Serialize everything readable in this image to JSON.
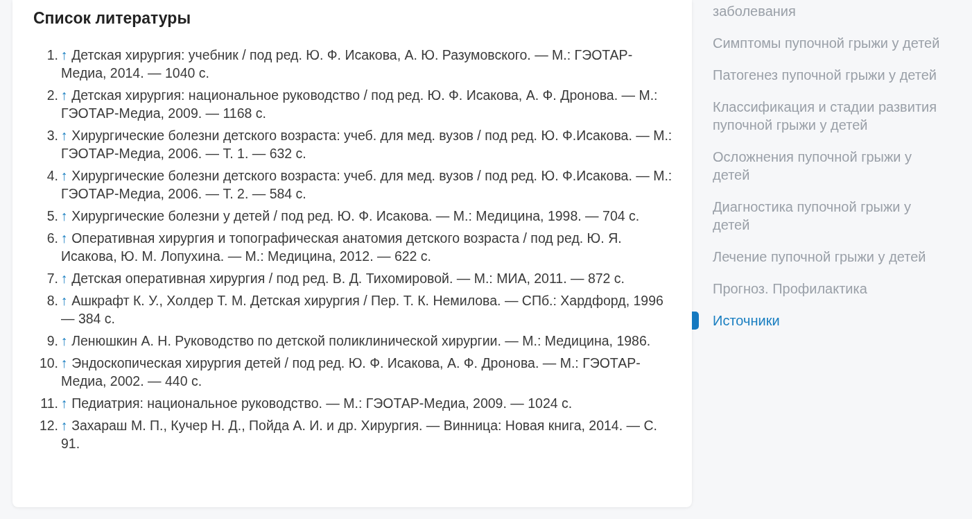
{
  "references": {
    "title": "Список литературы",
    "items": [
      {
        "number": "1.",
        "backlink": "↑",
        "text": "Детская хирургия: учебник / под ред. Ю. Ф. Исакова, А. Ю. Разумовского. — М.: ГЭОТАР-Медиа, 2014. — 1040 с."
      },
      {
        "number": "2.",
        "backlink": "↑",
        "text": "Детская хирургия: национальное руководство / под ред. Ю. Ф. Исакова, А. Ф. Дронова. — М.: ГЭОТАР-Медиа, 2009. — 1168 с."
      },
      {
        "number": "3.",
        "backlink": "↑",
        "text": "Хирургические болезни детского возраста: учеб. для мед. вузов / под ред. Ю. Ф.Исакова. — М.: ГЭОТАР-Медиа, 2006. — Т. 1. — 632 с."
      },
      {
        "number": "4.",
        "backlink": "↑",
        "text": "Хирургические болезни детского возраста: учеб. для мед. вузов / под ред. Ю. Ф.Исакова. — М.: ГЭОТАР-Медиа, 2006. — Т. 2. — 584 с."
      },
      {
        "number": "5.",
        "backlink": "↑",
        "text": "Хирургические болезни у детей / под ред. Ю. Ф. Исакова. — М.: Медицина, 1998. — 704 с."
      },
      {
        "number": "6.",
        "backlink": "↑",
        "text": "Оперативная хирургия и топографическая анатомия детского возраста / под ред. Ю. Я. Исакова, Ю. М. Лопухина. — М.: Медицина, 2012. — 622 с."
      },
      {
        "number": "7.",
        "backlink": "↑",
        "text": "Детская оперативная хирургия / под ред. В. Д. Тихомировой. — М.: МИА, 2011. — 872 с."
      },
      {
        "number": "8.",
        "backlink": "↑",
        "text": "Ашкрафт К. У., Холдер Т. М. Детская хирургия / Пер. Т. К. Немилова. — СПб.: Хардфорд, 1996 — 384 с."
      },
      {
        "number": "9.",
        "backlink": "↑",
        "text": "Ленюшкин А. Н. Руководство по детской поликлинической хирургии. — М.: Медицина, 1986."
      },
      {
        "number": "10.",
        "backlink": "↑",
        "text": "Эндоскопическая хирургия детей / под ред. Ю. Ф. Исакова, А. Ф. Дронова. — М.: ГЭОТАР-Медиа, 2002. — 440 с."
      },
      {
        "number": "11.",
        "backlink": "↑",
        "text": "Педиатрия: национальное руководство. — М.: ГЭОТАР-Медиа, 2009. — 1024 с."
      },
      {
        "number": "12.",
        "backlink": "↑",
        "text": "Захараш М. П., Кучер Н. Д., Пойда А. И. и др. Хирургия. — Винница: Новая книга, 2014. — С. 91."
      }
    ]
  },
  "sidebar": {
    "items": [
      {
        "label": "заболевания",
        "selected": false
      },
      {
        "label": "Симптомы пупочной грыжи у детей",
        "selected": false
      },
      {
        "label": "Патогенез пупочной грыжи у детей",
        "selected": false
      },
      {
        "label": "Классификация и стадии развития пупочной грыжи у детей",
        "selected": false
      },
      {
        "label": "Осложнения пупочной грыжи у детей",
        "selected": false
      },
      {
        "label": "Диагностика пупочной грыжи у детей",
        "selected": false
      },
      {
        "label": "Лечение пупочной грыжи у детей",
        "selected": false
      },
      {
        "label": "Прогноз. Профилактика",
        "selected": false
      },
      {
        "label": "Источники",
        "selected": true
      }
    ]
  }
}
